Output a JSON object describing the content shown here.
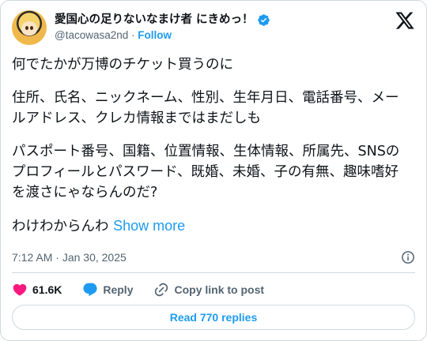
{
  "author": {
    "display_name": "愛国心の足りないなまけ者 にきめっ！",
    "handle": "@tacowasa2nd",
    "separator": "·",
    "follow_label": "Follow"
  },
  "post": {
    "paragraph1": "何でたかが万博のチケット買うのに",
    "paragraph2": "住所、氏名、ニックネーム、性別、生年月日、電話番号、メールアドレス、クレカ情報まではまだしも",
    "paragraph3": "パスポート番号、国籍、位置情報、生体情報、所属先、SNSのプロフィールとパスワード、既婚、未婚、子の有無、趣味嗜好を渡さにゃならんのだ?",
    "paragraph4": "わけわからんわ",
    "show_more": "Show more"
  },
  "meta": {
    "time": "7:12 AM",
    "separator": "·",
    "date": "Jan 30, 2025"
  },
  "actions": {
    "like_count": "61.6K",
    "reply_label": "Reply",
    "copy_link_label": "Copy link to post"
  },
  "replies_button": "Read 770 replies",
  "colors": {
    "accent": "#1d9bf0",
    "like": "#f91880",
    "text": "#0f1419",
    "muted": "#536471",
    "border": "#cfd9de"
  },
  "icons": {
    "verified": "verified-badge-icon",
    "brand": "x-logo-icon",
    "info": "info-icon",
    "like": "heart-icon",
    "reply": "speech-bubble-icon",
    "copy_link": "link-icon"
  }
}
